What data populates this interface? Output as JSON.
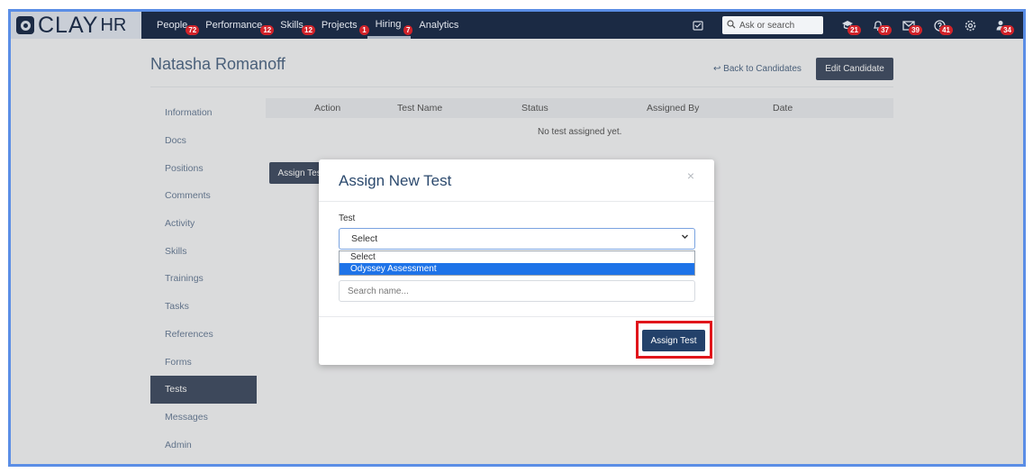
{
  "logo": {
    "word": "CLAY",
    "suffix": "HR"
  },
  "nav": [
    {
      "label": "People",
      "badge": "72"
    },
    {
      "label": "Performance",
      "badge": "12"
    },
    {
      "label": "Skills",
      "badge": "12"
    },
    {
      "label": "Projects",
      "badge": "1"
    },
    {
      "label": "Hiring",
      "badge": "7"
    },
    {
      "label": "Analytics",
      "badge": ""
    }
  ],
  "topbar": {
    "search_placeholder": "Ask or search",
    "icons": [
      {
        "name": "graduation-cap-icon",
        "badge": "21"
      },
      {
        "name": "bell-icon",
        "badge": "37"
      },
      {
        "name": "mail-icon",
        "badge": "39"
      },
      {
        "name": "help-icon",
        "badge": "41"
      },
      {
        "name": "gear-icon",
        "badge": ""
      },
      {
        "name": "user-icon",
        "badge": "34"
      }
    ]
  },
  "page": {
    "title": "Natasha Romanoff",
    "back_link": "Back to Candidates",
    "edit_button": "Edit Candidate"
  },
  "sidebar": [
    "Information",
    "Docs",
    "Positions",
    "Comments",
    "Activity",
    "Skills",
    "Trainings",
    "Tasks",
    "References",
    "Forms",
    "Tests",
    "Messages",
    "Admin"
  ],
  "table": {
    "headers": [
      "Action",
      "Test Name",
      "Status",
      "Assigned By",
      "Date"
    ],
    "empty": "No test assigned yet."
  },
  "background_button": "Assign Test",
  "modal": {
    "title": "Assign New Test",
    "close": "×",
    "test_label": "Test",
    "select_value": "Select",
    "options": [
      "Select",
      "Odyssey Assessment"
    ],
    "search_placeholder": "Search name...",
    "assign_button": "Assign Test"
  }
}
